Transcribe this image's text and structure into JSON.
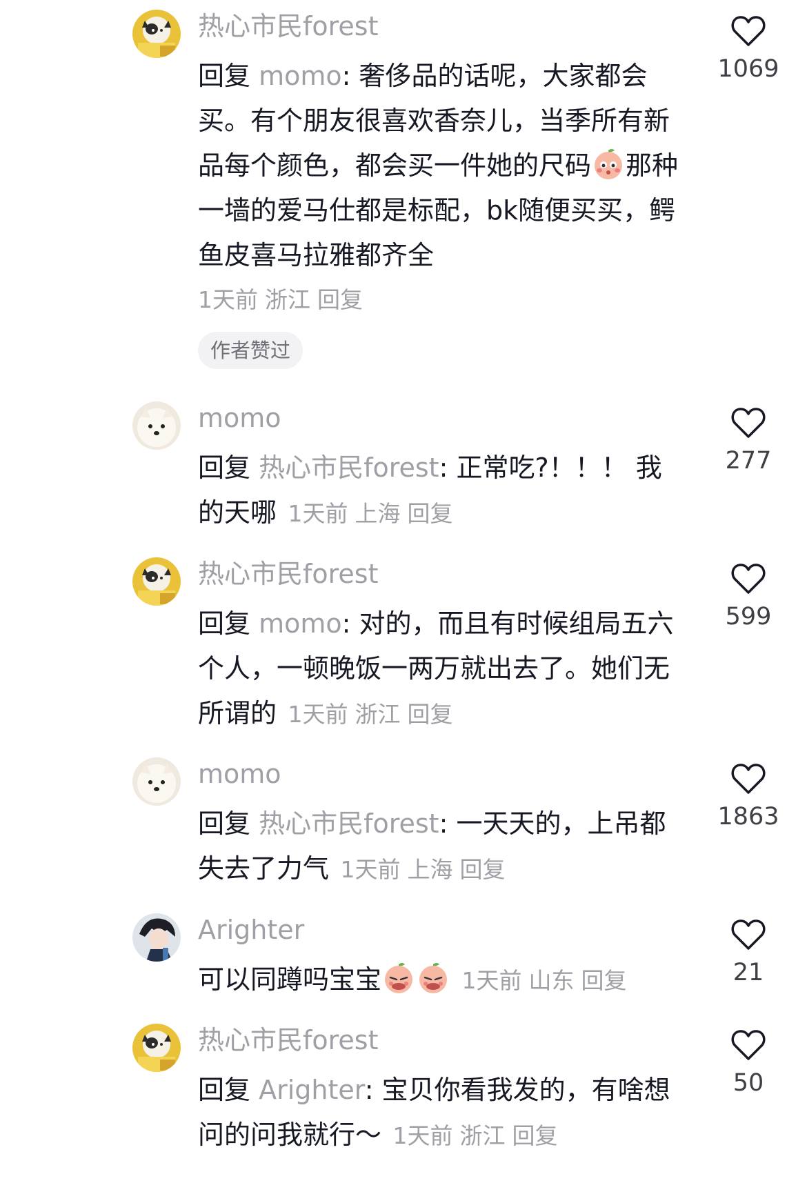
{
  "colors": {
    "muted": "#9fa0a5",
    "text": "#161823",
    "badge_bg": "#f2f2f4"
  },
  "comments": [
    {
      "username": "热心市民forest",
      "reply_prefix": "回复 ",
      "reply_target": "momo",
      "text_part1": ": 奢侈品的话呢，大家都会买。有个朋友很喜欢香奈儿，当季所有新品每个颜色，都会买一件她的尺码",
      "emoji": "blush-face",
      "text_part2": "那种一墙的爱马仕都是标配，bk随便买买，鳄鱼皮喜马拉雅都齐全",
      "time": "1天前",
      "location": "浙江",
      "reply_label": "回复",
      "badge": "作者赞过",
      "likes": "1069",
      "avatar_icon": "cat-avatar-icon"
    },
    {
      "username": "momo",
      "reply_prefix": "回复 ",
      "reply_target": "热心市民forest",
      "text": ": 正常吃?！！！ 我的天哪",
      "time": "1天前",
      "location": "上海",
      "reply_label": "回复",
      "likes": "277",
      "avatar_icon": "dog-avatar-icon"
    },
    {
      "username": "热心市民forest",
      "reply_prefix": "回复 ",
      "reply_target": "momo",
      "text": ": 对的，而且有时候组局五六个人，一顿晚饭一两万就出去了。她们无所谓的",
      "time": "1天前",
      "location": "浙江",
      "reply_label": "回复",
      "likes": "599",
      "avatar_icon": "cat-avatar-icon"
    },
    {
      "username": "momo",
      "reply_prefix": "回复 ",
      "reply_target": "热心市民forest",
      "text": ": 一天天的，上吊都失去了力气",
      "time": "1天前",
      "location": "上海",
      "reply_label": "回复",
      "likes": "1863",
      "avatar_icon": "dog-avatar-icon"
    },
    {
      "username": "Arighter",
      "text": "可以同蹲吗宝宝",
      "emoji": "pleading-face",
      "time": "1天前",
      "location": "山东",
      "reply_label": "回复",
      "likes": "21",
      "avatar_icon": "anime-avatar-icon"
    },
    {
      "username": "热心市民forest",
      "reply_prefix": "回复 ",
      "reply_target": "Arighter",
      "text": ": 宝贝你看我发的，有啥想问的问我就行～",
      "time": "1天前",
      "location": "浙江",
      "reply_label": "回复",
      "likes": "50",
      "avatar_icon": "cat-avatar-icon"
    }
  ]
}
